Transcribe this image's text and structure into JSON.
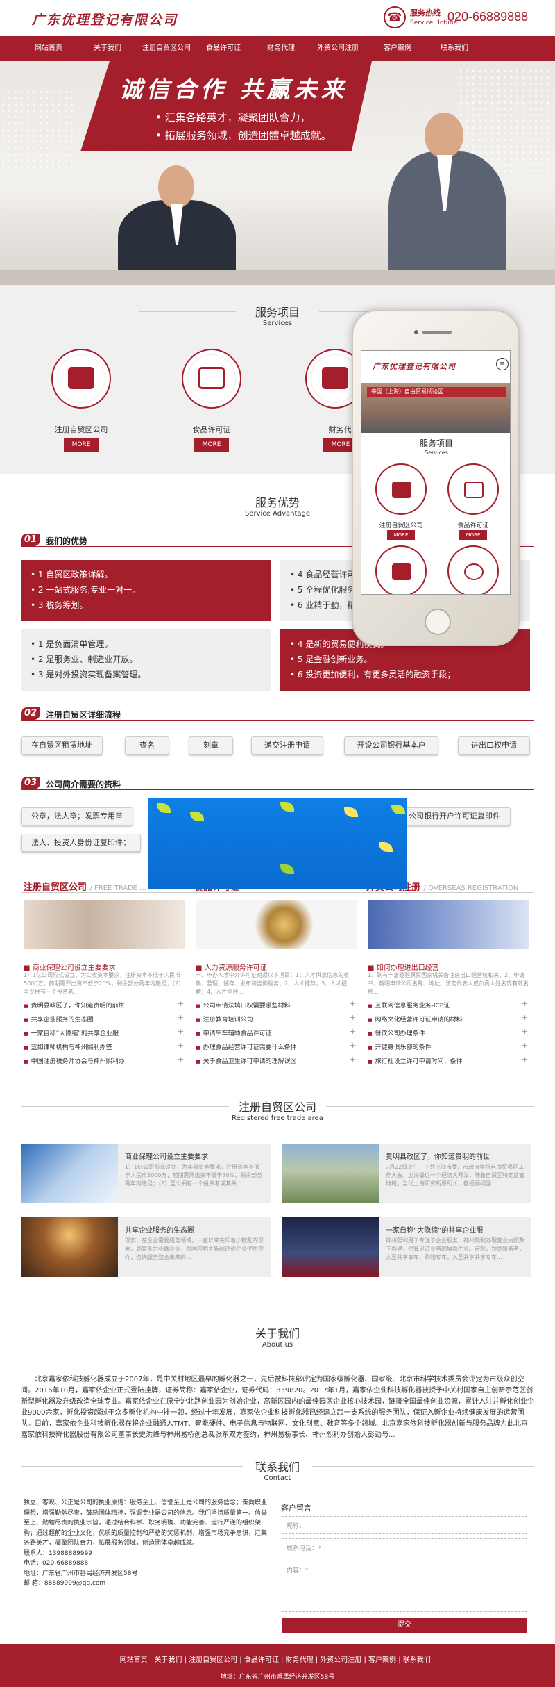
{
  "header": {
    "logo": "广东优理登记有限公司",
    "hotline_label": "服务热线",
    "hotline_sub": "Service Hotline",
    "hotline_number": "020-66889888"
  },
  "nav": [
    "网站首页",
    "关于我们",
    "注册自贸区公司",
    "食品许可证",
    "财务代理",
    "外资公司注册",
    "客户案例",
    "联系我们"
  ],
  "banner": {
    "title": "诚信合作  共赢未来",
    "line1": "• 汇集各路英才，凝聚团队合力，",
    "line2": "• 拓展服务领域，创造团體卓越成就。"
  },
  "services": {
    "title": "服务项目",
    "subtitle": "Services",
    "items": [
      {
        "name": "注册自贸区公司",
        "more": "MORE"
      },
      {
        "name": "食品许可证",
        "more": "MORE"
      },
      {
        "name": "财务代",
        "more": "MORE"
      }
    ]
  },
  "phone": {
    "logo": "广东优理登记有限公司",
    "menu_icon": "≡",
    "banner_text": "中国（上海）自由贸易试验区",
    "title": "服务项目",
    "subtitle": "Services",
    "items": [
      {
        "name": "注册自贸区公司",
        "more": "MORE"
      },
      {
        "name": "食品许可证",
        "more": "MORE"
      }
    ]
  },
  "advantage": {
    "title": "服务优势",
    "subtitle": "Service Advantage",
    "section_num": "01",
    "section_title": "我们的优势",
    "boxes": [
      [
        "• 1 自贸区政策详解。",
        "• 2 一站式服务,专业一对一。",
        "• 3 税务筹划。"
      ],
      [
        "• 4 食品经营许可",
        "• 5 全程优化服务",
        "• 6 业精于勤，精"
      ],
      [
        "• 1 是负面清单管理。",
        "• 2 是服务业、制造业开放。",
        "• 3 是对外投资实现备案管理。"
      ],
      [
        "• 4 是新的贸易便利模式。",
        "• 5 是金融创新业务。",
        "• 6 投资更加便利，有更多灵活的融资手段；"
      ]
    ]
  },
  "process": {
    "section_num": "02",
    "section_title": "注册自贸区详细流程",
    "steps": [
      "在自贸区租赁地址",
      "查名",
      "刻章",
      "递交注册申请",
      "开设公司银行基本户",
      "进出口权申请"
    ]
  },
  "documents": {
    "section_num": "03",
    "section_title": "公司简介需要的资料",
    "items": [
      "公章，法人章；发票专用章",
      "公司银行开户许可证复印件",
      "法人、投资人身份证复印件；"
    ]
  },
  "columns": [
    {
      "title": "注册自贸区公司",
      "tag": "/ FREE TRADE ...",
      "headline": "■ 商业保理公司设立主要要求",
      "summary": "1）1亿公司形式设立，为实收资本要求，注册资本不低于人民币5000万；前期需开出资不低于20%，剩余部分两年内缴足；（2）至少拥有一个投资者...",
      "list": [
        "贵明县政区了，你知道贵明的前世",
        "共享企业服务的生态圈",
        "一家自称“大隐缩”的共享企业服",
        "蓝如律师机构与神州熙利办签",
        "中国注册税务师协会与神州熙利办"
      ]
    },
    {
      "title": "食品许可证",
      "tag": "",
      "headline": "■ 人力资源服务许可证",
      "summary": "一、申办人才中介许可证时须以下项目：1：人才供求信息的收集、整理、储存、发布和咨询服务；2、人才推荐；3、人才招聘；4、人才测评...",
      "list": [
        "公司申请法填口权需要哪些材料",
        "注册教育培训公司",
        "申请午车辅助食品许可证",
        "办理食品经营许可证需要什么条件",
        "关于食品卫生许可申请的理解误区"
      ]
    },
    {
      "title": "外资公司注册",
      "tag": "/ OVERSEAS REGISTRATION",
      "headline": "■ 如何办理进出口经营",
      "summary": "1、到有丰富经验原贸国家机关备注进出口经营权和关，2、申请书，载明申请公司名称、地址、法定代表人或负责人姓名或有效名称...",
      "list": [
        "互联网信息服务业务-ICP证",
        "网络文化经营许可证申请的材料",
        "餐饮公司办理条件",
        "开健身俱乐部的条件",
        "旅行社设立许可申请时间、条件"
      ]
    }
  ],
  "free_trade": {
    "title": "注册自贸区公司",
    "subtitle": "Registered free trade area",
    "cards": [
      {
        "headline": "商业保理公司设立主要要求",
        "summary": "1）1亿公司形式设立，为实收资本要求，注册资本不低于人民币5000万；前期需开出资不低于20%，剩余部分两年内缴足；（2）至少拥有一个投资者或其关..."
      },
      {
        "headline": "贵明县政区了，你知道贵明的前世",
        "summary": "7月22日上午，中共上海市委、市政府举行自由贸易区工作大会。上海最近一个经济大开发，随着自贸区特定监管地域。当代上海研究所原所长、教授顾问国..."
      },
      {
        "headline": "共享企业服务的生态圈",
        "summary": "现实，在企业需要服务领域，一直以来充斥着小散乱的现象，到家多为小微企业，而国内相关新闻评论企业使用中介，咨询服务整合未来的..."
      },
      {
        "headline": "一家自称“大隐缩”的共享企业服",
        "summary": "神州熙利用于专注于企业服务，神州熙利办理营业执照数下面建，也算是过业务的层面生业。宏观，领到服务者，大至共享事车、购物专车，入至共享共享专车..."
      }
    ]
  },
  "about": {
    "title": "关于我们",
    "subtitle": "About us",
    "text": "北京嘉家依科技孵化器成立于2007年，是中关村地区最早的孵化器之一，先后被科技部评定为国家级孵化器、国家级、北京市科学技术委员会评定为市级众创空间。2016年10月，嘉家依企业正式登陆挂牌，证券简称：嘉家依企业，证券代码：839820。2017年1月，嘉家依企业科技孵化器被授予中关村国家自主创新示范区创新型孵化器及升级改造全球专业。嘉家依企业在原宁沪北路创业园为创始企业，高新区园内的最佳园区企业核心技术园，链接全国最佳创业资源，累计入驻并孵化创业企业9000余家，孵化投资超过于众多孵化机构中排一领，经过十年发展，嘉家依企业科技孵化器已经建立起一支系统的服务团队，保证入孵企业持续健康发展的运营团队。目前，嘉家依企业科技孵化器在将企业融通入TMT、智能硬件、电子信息与物联网、文化创意、教育等多个领域。北京嘉家依科技孵化器创新与服务品牌为此北京嘉家依科技孵化器股份有限公司董事长史洪峰与神州易桥创总裁张东双方签约，神州易桥事长、神州熙利办创始人彭劲与..."
  },
  "contact": {
    "title": "联系我们",
    "subtitle": "Contact",
    "intro": "独立、客观、公正是公司的执业原则：服务至上、信誉至上是公司的服务信念；奋向职业理想，增强勤勉尽责，鼓励团体精神，强调专业是公司的信念。我们坚持质量第一、信誉至上、勤勉尽责的执业宗旨，通过结合科学、职务明确、功能完善、运行严谨的组织架构；通过超前的企业文化，优质的质量控制和严格的奖惩机制，增强市场竞争意识，汇集各路英才，凝聚团队合力，拓展服务领域，创造团体卓越成就。",
    "phone": "联系人：13988889999",
    "tel": "电话：020-66889888",
    "address": "地址：广东省广州市番禺经济开发区58号",
    "email": "邮 箱：88889999@qq.com",
    "form": {
      "title": "客户留言",
      "name": "昵称：",
      "phone": "联系电话：*",
      "content": "内容：*",
      "submit": "提交"
    }
  },
  "footer": {
    "nav": "网站首页  |  关于我们  |  注册自贸区公司  |  食品许可证  |  财务代理  |  外资公司注册  |  客户案例  |  联系我们  |",
    "address": "地址：广东省广州市番禺经济开发区58号"
  },
  "colors": {
    "brand": "#a41e2c",
    "light_bg": "#f1f0f0"
  }
}
